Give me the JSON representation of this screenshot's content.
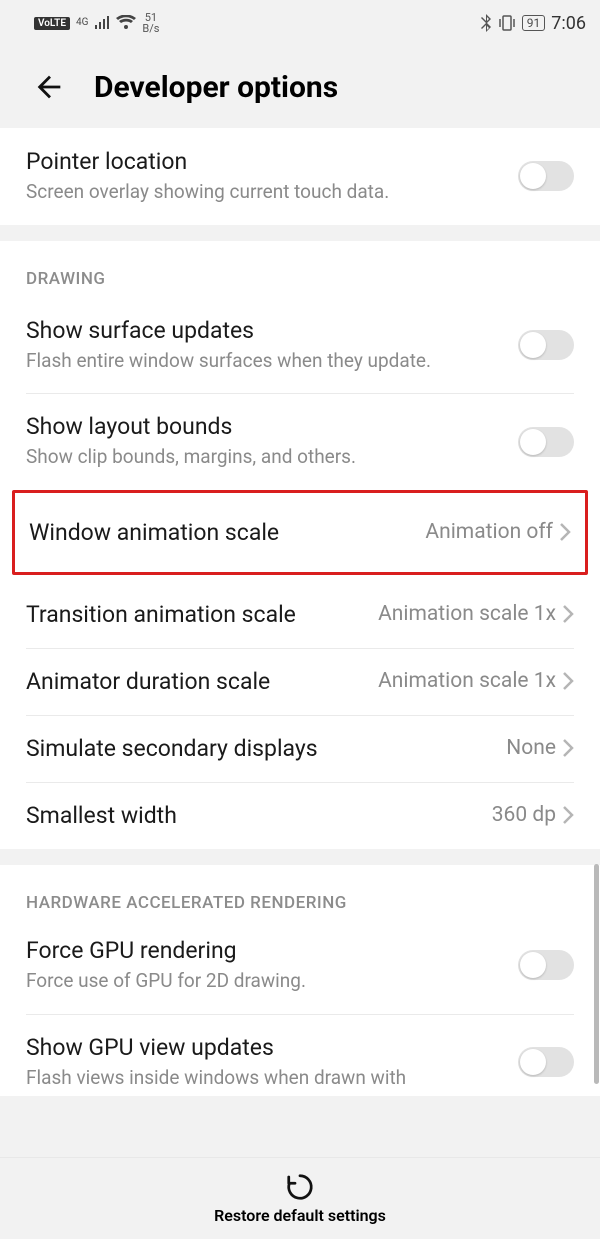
{
  "status": {
    "volte": "VoLTE",
    "net_type": "4G",
    "speed_value": "51",
    "speed_unit": "B/s",
    "battery": "91",
    "time": "7:06"
  },
  "header": {
    "title": "Developer options"
  },
  "rows": {
    "pointer_title": "Pointer location",
    "pointer_sub": "Screen overlay showing current touch data.",
    "section_drawing": "Drawing",
    "surface_title": "Show surface updates",
    "surface_sub": "Flash entire window surfaces when they update.",
    "layout_title": "Show layout bounds",
    "layout_sub": "Show clip bounds, margins, and others.",
    "window_anim_title": "Window animation scale",
    "window_anim_value": "Animation off",
    "transition_title": "Transition animation scale",
    "transition_value": "Animation scale 1x",
    "animator_title": "Animator duration scale",
    "animator_value": "Animation scale 1x",
    "simulate_title": "Simulate secondary displays",
    "simulate_value": "None",
    "smallest_title": "Smallest width",
    "smallest_value": "360 dp",
    "section_hw": "Hardware Accelerated Rendering",
    "force_gpu_title": "Force GPU rendering",
    "force_gpu_sub": "Force use of GPU for 2D drawing.",
    "gpu_updates_title": "Show GPU view updates",
    "gpu_updates_sub": "Flash views inside windows when drawn with"
  },
  "footer": {
    "label": "Restore default settings"
  }
}
